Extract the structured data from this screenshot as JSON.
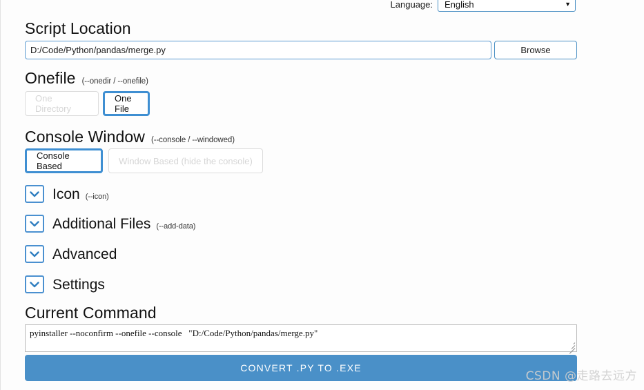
{
  "language_bar": {
    "label": "Language:",
    "selected": "English",
    "options": [
      "English"
    ],
    "caret_icon": "chevron-down-icon"
  },
  "script_location": {
    "heading": "Script Location",
    "path_value": "D:/Code/Python/pandas/merge.py",
    "path_placeholder": "",
    "browse_label": "Browse"
  },
  "onefile": {
    "heading": "Onefile",
    "flag": "(--onedir / --onefile)",
    "options": [
      {
        "label": "One Directory",
        "selected": false
      },
      {
        "label": "One File",
        "selected": true
      }
    ]
  },
  "console_window": {
    "heading": "Console Window",
    "flag": "(--console / --windowed)",
    "options": [
      {
        "label": "Console Based",
        "selected": true
      },
      {
        "label": "Window Based (hide the console)",
        "selected": false
      }
    ]
  },
  "sections": [
    {
      "label": "Icon",
      "flag": "(--icon)",
      "expanded": false,
      "icon": "chevron-down-icon"
    },
    {
      "label": "Additional Files",
      "flag": "(--add-data)",
      "expanded": false,
      "icon": "chevron-down-icon"
    },
    {
      "label": "Advanced",
      "flag": "",
      "expanded": false,
      "icon": "chevron-down-icon"
    },
    {
      "label": "Settings",
      "flag": "",
      "expanded": false,
      "icon": "chevron-down-icon"
    }
  ],
  "current_command": {
    "heading": "Current Command",
    "value": "pyinstaller --noconfirm --onefile --console   \"D:/Code/Python/pandas/merge.py\""
  },
  "convert": {
    "label": "CONVERT .PY TO .EXE"
  },
  "watermark": {
    "text": "CSDN @走路去远方"
  },
  "colors": {
    "accent_blue": "#4a90c8",
    "selected_border": "#3f8fd2",
    "input_border": "#5b9bd1",
    "disabled_text": "#d6d6d6",
    "disabled_border": "#dcdcdc",
    "page_bg": "#fdfdfd"
  }
}
